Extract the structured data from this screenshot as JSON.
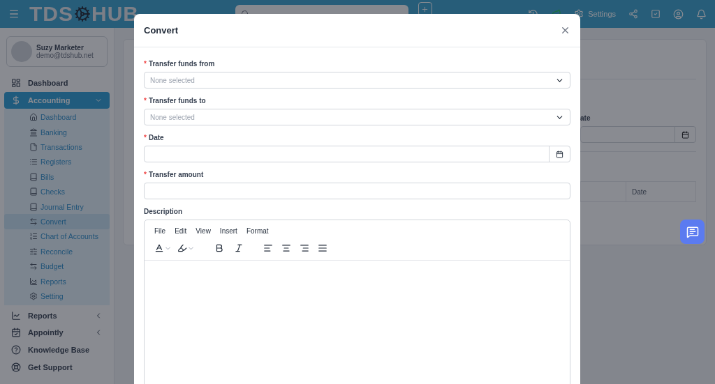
{
  "header": {
    "logo_left": "TDS",
    "logo_right": "HUB",
    "settings": "Settings"
  },
  "user": {
    "name": "Suzy Marketer",
    "email": "demo@tdshub.net"
  },
  "nav": [
    {
      "label": "Dashboard",
      "kind": "link",
      "selected": false
    },
    {
      "label": "Accounting",
      "kind": "group",
      "selected": true,
      "expanded": true,
      "children": [
        {
          "label": "Dashboard",
          "selected": false
        },
        {
          "label": "Banking",
          "selected": false
        },
        {
          "label": "Transactions",
          "selected": false
        },
        {
          "label": "Registers",
          "selected": false
        },
        {
          "label": "Bills",
          "selected": false
        },
        {
          "label": "Checks",
          "selected": false
        },
        {
          "label": "Journal Entry",
          "selected": false
        },
        {
          "label": "Convert",
          "selected": true
        },
        {
          "label": "Chart of Accounts",
          "selected": false
        },
        {
          "label": "Reconcile",
          "selected": false
        },
        {
          "label": "Budget",
          "selected": false
        },
        {
          "label": "Reports",
          "selected": false
        },
        {
          "label": "Setting",
          "selected": false
        }
      ]
    },
    {
      "label": "Reports",
      "kind": "group",
      "selected": false,
      "expanded": false
    },
    {
      "label": "Appointly",
      "kind": "group",
      "selected": false,
      "expanded": false
    },
    {
      "label": "Knowledge Base",
      "kind": "link",
      "selected": false
    },
    {
      "label": "Get Support",
      "kind": "link",
      "selected": false
    }
  ],
  "background": {
    "partial_label": "ate",
    "table_column": "Date"
  },
  "modal": {
    "title": "Convert",
    "fields": [
      {
        "label": "Transfer funds from",
        "required_mark": "*",
        "kind": "select",
        "placeholder": "None selected"
      },
      {
        "label": "Transfer funds to",
        "required_mark": "*",
        "kind": "select",
        "placeholder": "None selected"
      },
      {
        "label": "Date",
        "required_mark": "*",
        "kind": "date"
      },
      {
        "label": "Transfer amount",
        "required_mark": "*",
        "kind": "text"
      },
      {
        "label": "Description",
        "kind": "editor",
        "menu": [
          "File",
          "Edit",
          "View",
          "Insert",
          "Format"
        ]
      }
    ]
  }
}
